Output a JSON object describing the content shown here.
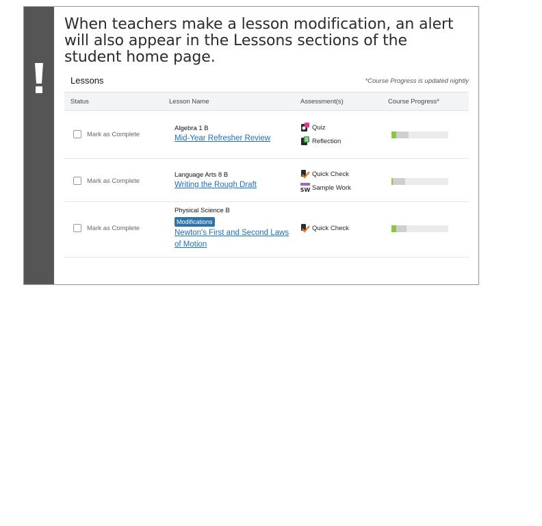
{
  "callout": {
    "text": "When teachers make a lesson modification, an alert will also appear in the Lessons sections of the student home page."
  },
  "lessons": {
    "title": "Lessons",
    "progress_note": "*Course Progress is updated nightly",
    "columns": [
      "Status",
      "Lesson Name",
      "Assessment(s)",
      "Course Progress*"
    ],
    "rows": [
      {
        "status_label": "Mark as Complete",
        "course": "Algebra 1 B",
        "lesson": "Mid-Year Refresher Review",
        "assessments": [
          {
            "label": "Quiz",
            "icon": "quiz-icon"
          },
          {
            "label": "Reflection",
            "icon": "reflection-icon"
          }
        ],
        "progress": {
          "complete": 0.08,
          "in_progress": 0.22
        }
      },
      {
        "status_label": "Mark as Complete",
        "course": "Language Arts 8 B",
        "lesson": "Writing the Rough Draft",
        "assessments": [
          {
            "label": "Quick Check",
            "icon": "quick-check-icon"
          },
          {
            "label": "Sample Work",
            "icon": "sample-work-icon"
          }
        ],
        "progress": {
          "complete": 0.03,
          "in_progress": 0.21
        }
      },
      {
        "status_label": "Mark as Complete",
        "course": "Physical Science B",
        "badge": "Modifications",
        "lesson": "Newton's First and Second Laws of Motion",
        "assessments": [
          {
            "label": "Quick Check",
            "icon": "quick-check-icon"
          }
        ],
        "progress": {
          "complete": 0.08,
          "in_progress": 0.19
        }
      }
    ]
  },
  "colors": {
    "sidebar": "#555555",
    "link": "#1a6fbf",
    "badge": "#2f72a9",
    "progress_complete": "#8cc63f",
    "progress_in_progress": "#cfcfcf"
  }
}
